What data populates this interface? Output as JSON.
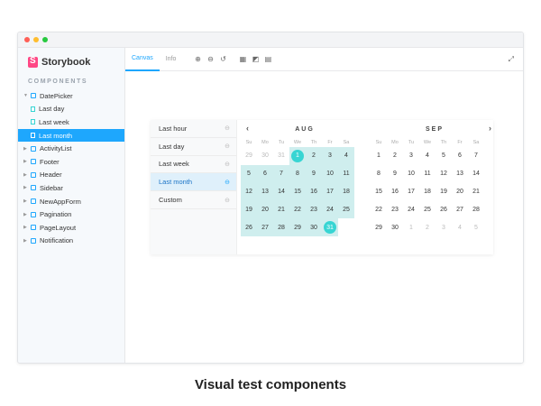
{
  "app": {
    "brand": "Storybook",
    "section_label": "COMPONENTS"
  },
  "sidebar": {
    "items": [
      {
        "label": "DatePicker",
        "type": "component",
        "expanded": true
      },
      {
        "label": "Last day",
        "type": "story"
      },
      {
        "label": "Last week",
        "type": "story"
      },
      {
        "label": "Last month",
        "type": "story",
        "active": true
      },
      {
        "label": "ActivityList",
        "type": "component"
      },
      {
        "label": "Footer",
        "type": "component"
      },
      {
        "label": "Header",
        "type": "component"
      },
      {
        "label": "Sidebar",
        "type": "component"
      },
      {
        "label": "NewAppForm",
        "type": "component"
      },
      {
        "label": "Pagination",
        "type": "component"
      },
      {
        "label": "PageLayout",
        "type": "component"
      },
      {
        "label": "Notification",
        "type": "component"
      }
    ]
  },
  "toolbar": {
    "tabs": [
      {
        "label": "Canvas",
        "active": true
      },
      {
        "label": "Info"
      }
    ],
    "tools": [
      "zoom-in-icon",
      "zoom-out-icon",
      "zoom-reset-icon",
      "grid-icon",
      "background-icon",
      "outline-icon"
    ],
    "fullscreen_icon": "fullscreen-icon"
  },
  "datepicker": {
    "ranges": [
      {
        "label": "Last hour"
      },
      {
        "label": "Last day"
      },
      {
        "label": "Last week"
      },
      {
        "label": "Last month",
        "active": true
      },
      {
        "label": "Custom"
      }
    ],
    "weekdays": [
      "Su",
      "Mo",
      "Tu",
      "We",
      "Th",
      "Fr",
      "Sa"
    ],
    "months": [
      {
        "name": "AUG",
        "nav": "‹",
        "days": [
          {
            "d": "29",
            "m": true
          },
          {
            "d": "30",
            "m": true
          },
          {
            "d": "31",
            "m": true
          },
          {
            "d": "1",
            "r": true,
            "s": true
          },
          {
            "d": "2",
            "r": true
          },
          {
            "d": "3",
            "r": true
          },
          {
            "d": "4",
            "r": true
          },
          {
            "d": "5",
            "r": true
          },
          {
            "d": "6",
            "r": true
          },
          {
            "d": "7",
            "r": true
          },
          {
            "d": "8",
            "r": true
          },
          {
            "d": "9",
            "r": true
          },
          {
            "d": "10",
            "r": true
          },
          {
            "d": "11",
            "r": true
          },
          {
            "d": "12",
            "r": true
          },
          {
            "d": "13",
            "r": true
          },
          {
            "d": "14",
            "r": true
          },
          {
            "d": "15",
            "r": true
          },
          {
            "d": "16",
            "r": true
          },
          {
            "d": "17",
            "r": true
          },
          {
            "d": "18",
            "r": true
          },
          {
            "d": "19",
            "r": true
          },
          {
            "d": "20",
            "r": true
          },
          {
            "d": "21",
            "r": true
          },
          {
            "d": "22",
            "r": true
          },
          {
            "d": "23",
            "r": true
          },
          {
            "d": "24",
            "r": true
          },
          {
            "d": "25",
            "r": true
          },
          {
            "d": "26",
            "r": true
          },
          {
            "d": "27",
            "r": true
          },
          {
            "d": "28",
            "r": true
          },
          {
            "d": "29",
            "r": true
          },
          {
            "d": "30",
            "r": true
          },
          {
            "d": "31",
            "r": true,
            "s": true
          },
          {
            "d": ""
          }
        ]
      },
      {
        "name": "SEP",
        "nav": "›",
        "days": [
          {
            "d": "1"
          },
          {
            "d": "2"
          },
          {
            "d": "3"
          },
          {
            "d": "4"
          },
          {
            "d": "5"
          },
          {
            "d": "6"
          },
          {
            "d": "7"
          },
          {
            "d": "8"
          },
          {
            "d": "9"
          },
          {
            "d": "10"
          },
          {
            "d": "11"
          },
          {
            "d": "12"
          },
          {
            "d": "13"
          },
          {
            "d": "14"
          },
          {
            "d": "15"
          },
          {
            "d": "16"
          },
          {
            "d": "17"
          },
          {
            "d": "18"
          },
          {
            "d": "19"
          },
          {
            "d": "20"
          },
          {
            "d": "21"
          },
          {
            "d": "22"
          },
          {
            "d": "23"
          },
          {
            "d": "24"
          },
          {
            "d": "25"
          },
          {
            "d": "26"
          },
          {
            "d": "27"
          },
          {
            "d": "28"
          },
          {
            "d": "29"
          },
          {
            "d": "30"
          },
          {
            "d": "1",
            "m": true
          },
          {
            "d": "2",
            "m": true
          },
          {
            "d": "3",
            "m": true
          },
          {
            "d": "4",
            "m": true
          },
          {
            "d": "5",
            "m": true
          }
        ]
      }
    ]
  },
  "caption": "Visual test components",
  "colors": {
    "accent": "#1ea7fd",
    "brand": "#ff4785",
    "range": "#cfeeee",
    "selected": "#37d5d3"
  }
}
